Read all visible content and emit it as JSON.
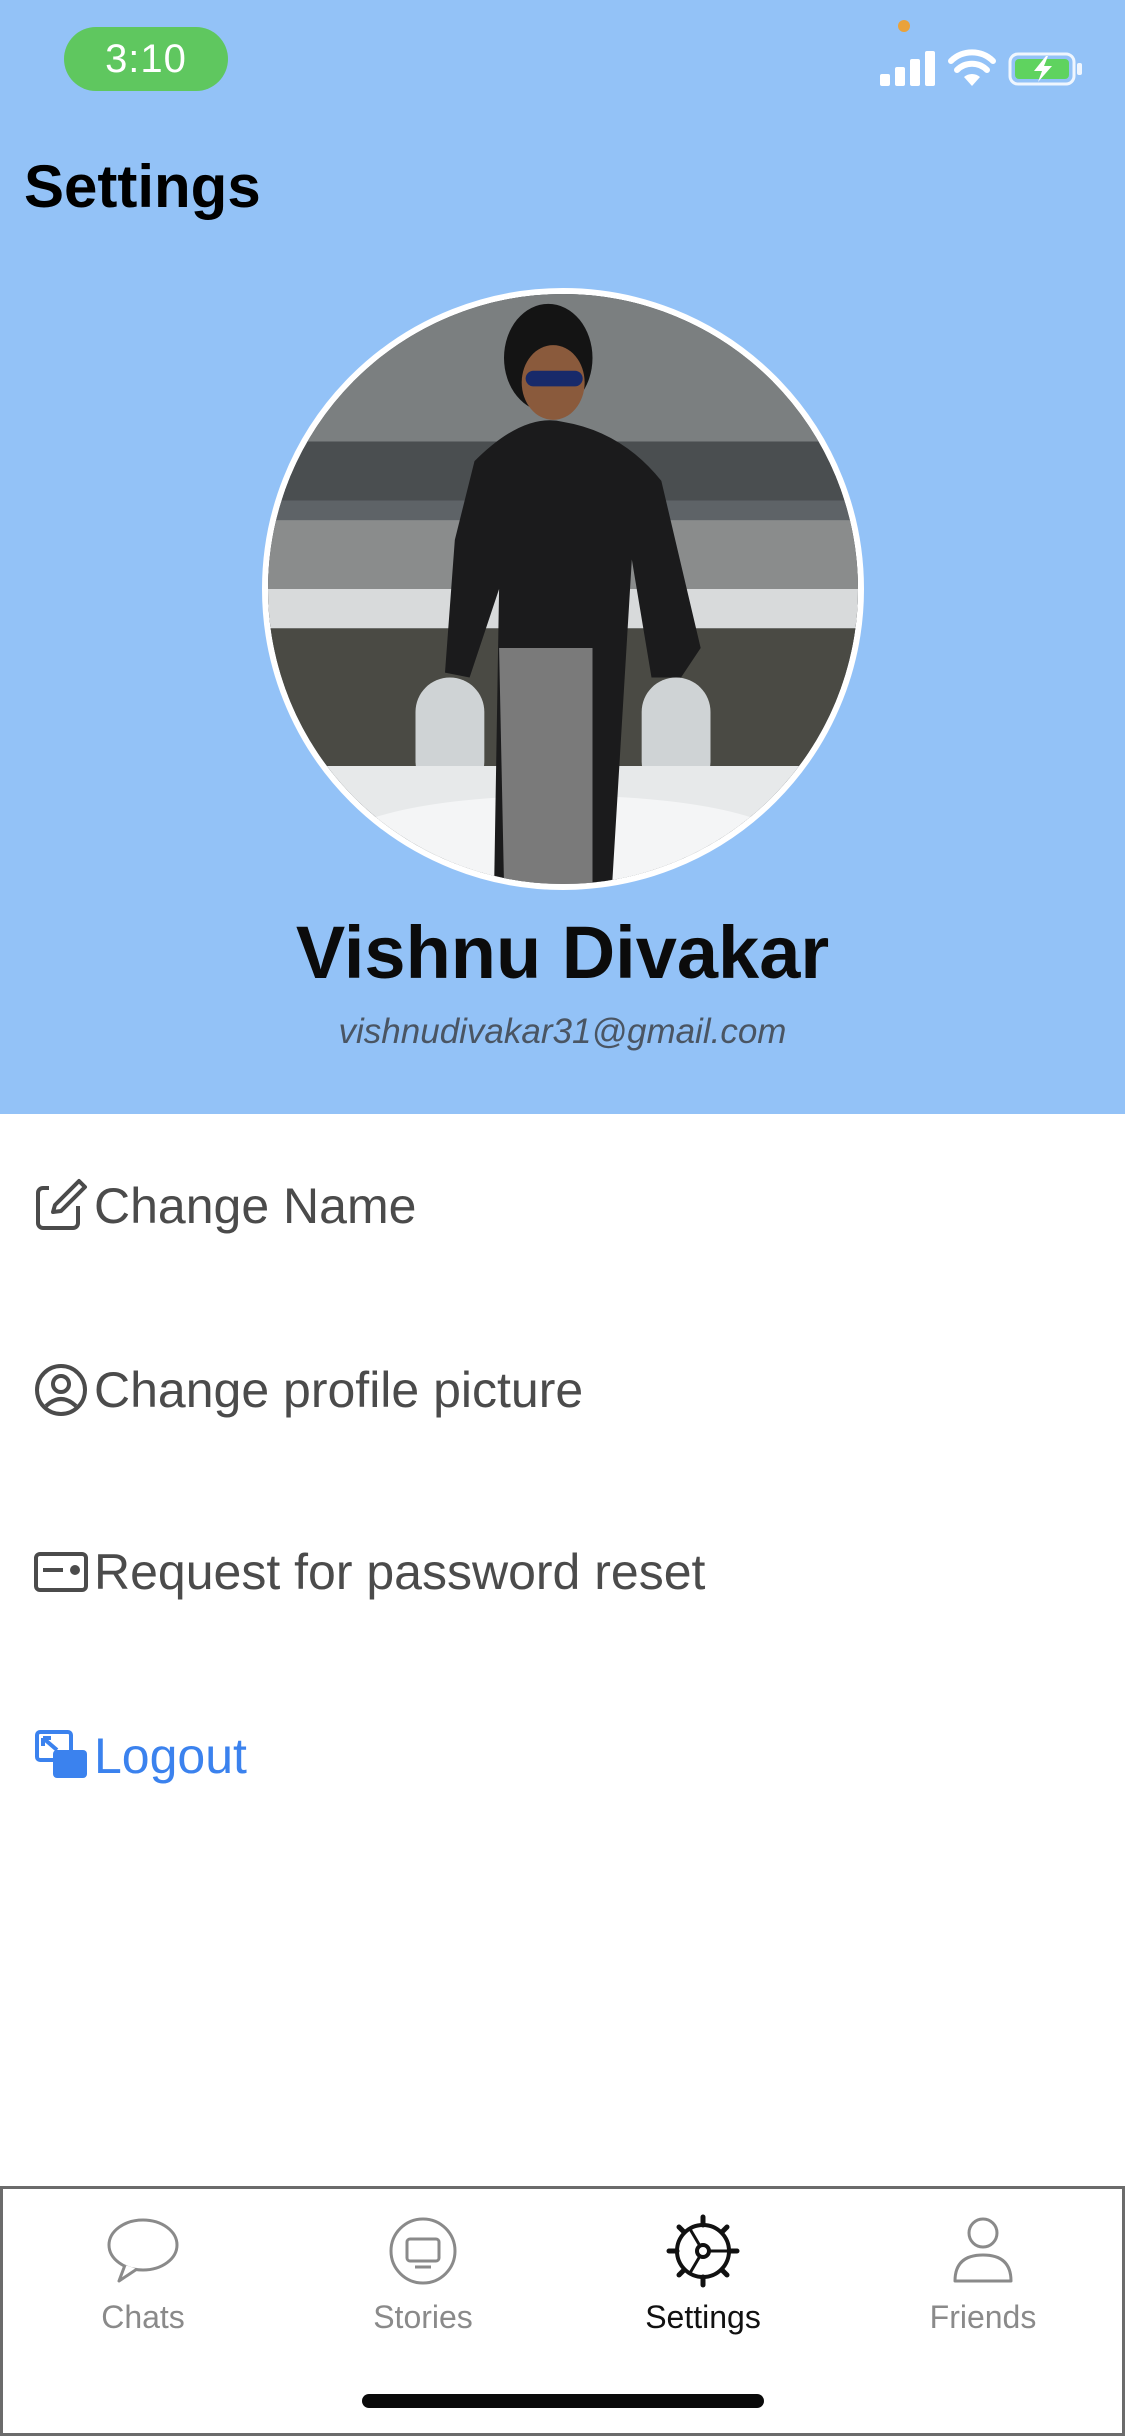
{
  "status_bar": {
    "time": "3:10"
  },
  "header": {
    "title": "Settings",
    "background_color": "#93c2f7"
  },
  "profile": {
    "name": "Vishnu Divakar",
    "email": "vishnudivakar31@gmail.com",
    "avatar": "profile-photo"
  },
  "menu": {
    "items": [
      {
        "label": "Change Name",
        "icon": "edit-icon"
      },
      {
        "label": "Change profile picture",
        "icon": "user-circle-icon"
      },
      {
        "label": "Request for password reset",
        "icon": "id-card-icon"
      },
      {
        "label": "Logout",
        "icon": "logout-icon",
        "color": "#3b82ee"
      }
    ]
  },
  "tabbar": {
    "tabs": [
      {
        "label": "Chats",
        "icon": "chat-bubble-icon",
        "active": false
      },
      {
        "label": "Stories",
        "icon": "tv-icon",
        "active": false
      },
      {
        "label": "Settings",
        "icon": "gear-icon",
        "active": true
      },
      {
        "label": "Friends",
        "icon": "person-icon",
        "active": false
      }
    ]
  },
  "colors": {
    "accent": "#3b82ee",
    "time_pill": "#5fc75f"
  }
}
